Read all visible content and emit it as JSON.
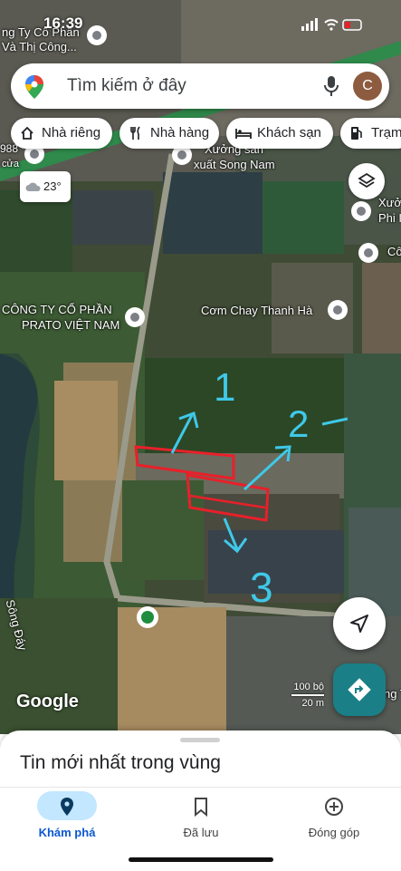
{
  "status_bar": {
    "time": "16:39"
  },
  "search": {
    "placeholder": "Tìm kiếm ở đây",
    "avatar_letter": "C"
  },
  "chips": [
    {
      "label": "Nhà riêng",
      "icon": "home-icon"
    },
    {
      "label": "Nhà hàng",
      "icon": "restaurant-icon"
    },
    {
      "label": "Khách sạn",
      "icon": "hotel-icon"
    },
    {
      "label": "Trạm",
      "icon": "gas-station-icon"
    }
  ],
  "weather": {
    "temp": "23°"
  },
  "map_labels": {
    "top_left_1": "ng Ty Cổ Phần",
    "top_left_2": "Và Thị Công...",
    "left_num": "988",
    "left_cua": "cửa",
    "xuong1": "Xưởng sản",
    "xuong2": "xuất Song Nam",
    "right_x1": "Xưở",
    "right_x2": "Phi I",
    "right_co": "Cô",
    "prato1": "CÔNG TY CỔ PHẦN",
    "prato2": "PRATO VIỆT NAM",
    "com_chay": "Cơm Chay Thanh Hà",
    "song_day": "Sông Đáy",
    "right_lower": "ng T"
  },
  "annotations": {
    "n1": "1",
    "n2": "2",
    "n3": "3"
  },
  "google_logo": "Google",
  "scale": {
    "ft": "100 bộ",
    "m": "20 m"
  },
  "bottom_sheet": {
    "title": "Tin mới nhất trong vùng"
  },
  "nav": {
    "explore": "Khám phá",
    "saved": "Đã lưu",
    "contribute": "Đóng góp"
  },
  "colors": {
    "accent": "#0b57d0",
    "annotation_cyan": "#3fc8e8",
    "annotation_red": "#e8202a",
    "directions_teal": "#1a7f86"
  }
}
